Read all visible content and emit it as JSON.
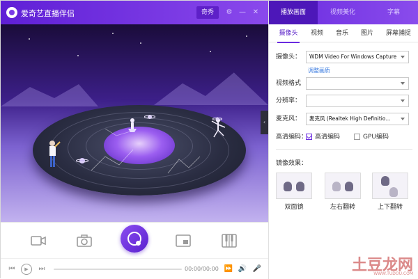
{
  "app": {
    "title": "爱奇艺直播伴侣",
    "qixiu_button": "奇秀"
  },
  "main_tabs": [
    {
      "label": "播放画面",
      "active": true
    },
    {
      "label": "视频美化",
      "active": false
    },
    {
      "label": "字幕",
      "active": false
    }
  ],
  "sub_tabs": [
    {
      "label": "摄像头",
      "active": true
    },
    {
      "label": "视频",
      "active": false
    },
    {
      "label": "音乐",
      "active": false
    },
    {
      "label": "图片",
      "active": false
    },
    {
      "label": "屏幕捕捉",
      "active": false
    }
  ],
  "camera_settings": {
    "camera_label": "摄像头：",
    "camera_value": "WDM Video For Windows Capture ...",
    "adjust_link": "调整画质",
    "format_label": "视频格式",
    "format_value": "",
    "resolution_label": "分辨率：",
    "resolution_value": "",
    "mic_label": "麦克风：",
    "mic_value": "麦克风 (Realtek High Definitio...",
    "hd_label": "高清编码：",
    "hd_checkbox_label": "高清编码",
    "hd_checked": true,
    "gpu_checkbox_label": "GPU编码",
    "gpu_checked": false
  },
  "mirror": {
    "title": "镜像效果：",
    "options": [
      {
        "label": "双面镜"
      },
      {
        "label": "左右翻转"
      },
      {
        "label": "上下翻转"
      }
    ]
  },
  "player": {
    "time": "00:00/00:00",
    "progress": 0
  },
  "icons": {
    "logo": "logo-icon",
    "settings": "gear-icon",
    "minimize": "minimize-icon",
    "close": "close-icon",
    "camera": "video-camera-icon",
    "snapshot": "photo-camera-icon",
    "live": "live-broadcast-icon",
    "pip": "picture-in-picture-icon",
    "piano": "piano-icon",
    "prev": "previous-icon",
    "play": "play-icon",
    "next": "next-icon",
    "volume": "volume-icon",
    "microphone": "microphone-icon",
    "collapse": "chevron-left-icon"
  },
  "colors": {
    "accent": "#6a2be0",
    "title_bar": "#7a3be6",
    "active_tab": "#4d17b9",
    "link": "#3a7be0"
  },
  "watermark": {
    "main": "土豆龙网",
    "sub": "WWW.TUDOU.COM"
  }
}
